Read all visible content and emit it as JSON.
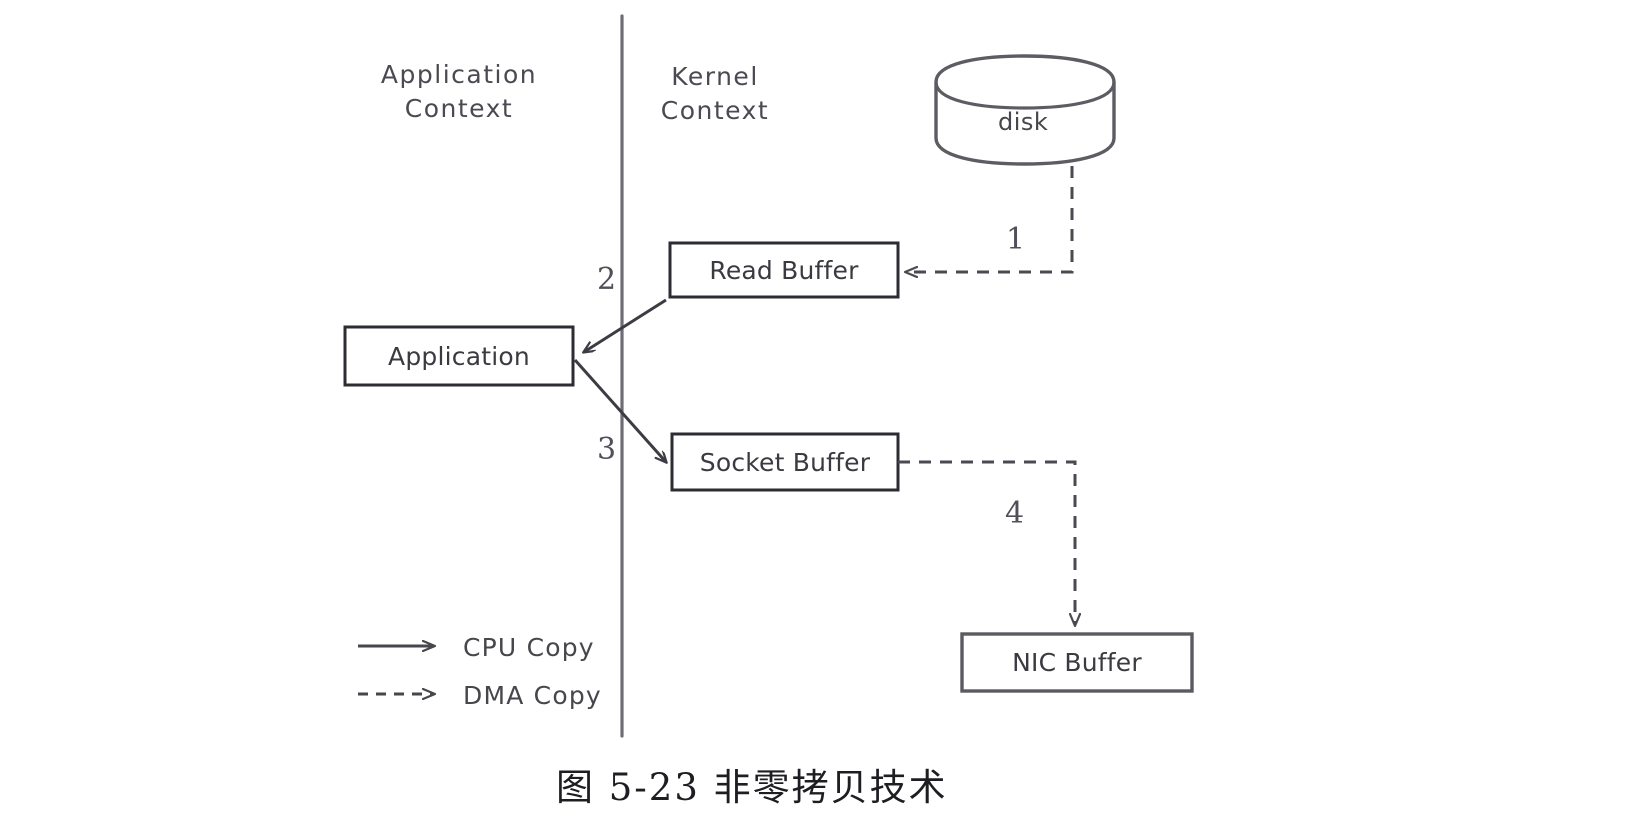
{
  "figure": {
    "caption": "图 5-23   非零拷贝技术",
    "background_color": "#ffffff",
    "stroke_color": "#4a4a52",
    "text_color": "#3a3a40"
  },
  "contexts": [
    {
      "id": "application-context",
      "label": "Application\nContext"
    },
    {
      "id": "kernel-context",
      "label": "Kernel\nContext"
    }
  ],
  "divider": {
    "name": "context-divider-line"
  },
  "nodes": {
    "disk": {
      "label": "disk"
    },
    "read_buffer": {
      "label": "Read Buffer"
    },
    "application": {
      "label": "Application"
    },
    "socket_buffer": {
      "label": "Socket Buffer"
    },
    "nic_buffer": {
      "label": "NIC Buffer"
    }
  },
  "steps": [
    {
      "number": "1",
      "from": "disk",
      "to": "read_buffer",
      "kind": "DMA Copy"
    },
    {
      "number": "2",
      "from": "read_buffer",
      "to": "application",
      "kind": "CPU Copy"
    },
    {
      "number": "3",
      "from": "application",
      "to": "socket_buffer",
      "kind": "CPU Copy"
    },
    {
      "number": "4",
      "from": "socket_buffer",
      "to": "nic_buffer",
      "kind": "DMA Copy"
    }
  ],
  "step_numbers": {
    "one": "1",
    "two": "2",
    "three": "3",
    "four": "4"
  },
  "legend": {
    "items": [
      {
        "id": "cpu-copy",
        "label": "CPU  Copy",
        "style": "solid"
      },
      {
        "id": "dma-copy",
        "label": "DMA Copy",
        "style": "dashed"
      }
    ],
    "cpu_label": "CPU  Copy",
    "dma_label": "DMA Copy"
  }
}
